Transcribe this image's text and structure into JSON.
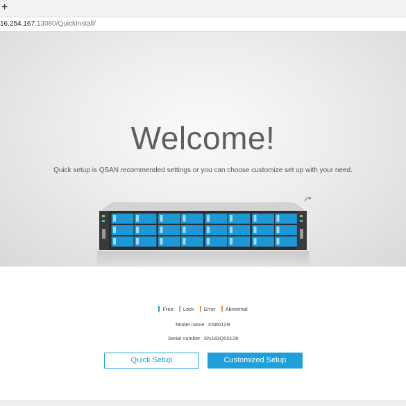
{
  "browser": {
    "new_tab_glyph": "+",
    "url_host": "16.254.167",
    "url_rest": ":13080/QuickInstall/"
  },
  "welcome": {
    "title": "Welcome!",
    "subtitle": "Quick setup is QSAN recommended settings or you can choose customize set up with your need."
  },
  "server_image": {
    "drive_columns": 4,
    "drive_rows": 3,
    "drive_color": "#1d98d6"
  },
  "legend": [
    {
      "label": "Free",
      "color": "#1d98d6"
    },
    {
      "label": "Lock",
      "color": "#a9a9a9"
    },
    {
      "label": "Error",
      "color": "#f08c3c"
    },
    {
      "label": "Abnormal",
      "color": "#f08c3c"
    }
  ],
  "device": {
    "model_label": "Model name",
    "model_value": "XN8012R",
    "serial_label": "Serial number",
    "serial_value": "XN183Q00128"
  },
  "actions": {
    "quick_setup": "Quick Setup",
    "customized_setup": "Customized Setup"
  },
  "colors": {
    "accent": "#1fa0d8"
  }
}
